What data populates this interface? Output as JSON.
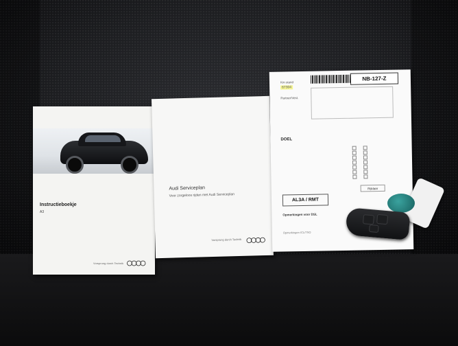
{
  "booklet_a3": {
    "title": "Instructieboekje",
    "subtitle": "A3",
    "footer": "Vorsprung durch Technik",
    "brand": "Audi"
  },
  "booklet_service": {
    "title": "Audi Serviceplan",
    "subtitle": "Voor zorgeloos rijden met Audi Serviceplan",
    "footer": "Vorsprung durch Technik",
    "brand": "Audi"
  },
  "form": {
    "km_label": "Km stand",
    "km_value": "67304",
    "partner_label": "Partner/Vest.",
    "license_plate": "NB-127-Z",
    "doel_title": "DOEL",
    "reg_code": "AL3A / RMT",
    "opmerkingen_label": "Opmerkingen voor DSL",
    "opmerkingen_label_2": "Opmerkingen ICL/TSO",
    "status_text": "Rijklaar"
  },
  "colors": {
    "seat_fabric": "#2c2d31",
    "paper": "#f4f4f2",
    "key_tag_teal": "#3aa29e"
  }
}
